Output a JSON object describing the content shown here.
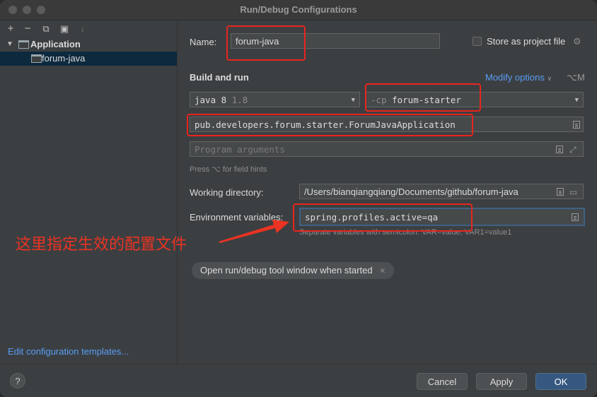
{
  "window": {
    "title": "Run/Debug Configurations"
  },
  "sidebar": {
    "toolbar": [
      {
        "icon": "add-icon",
        "glyph": "+"
      },
      {
        "icon": "remove-icon",
        "glyph": "−"
      },
      {
        "icon": "copy-icon",
        "glyph": "⧉"
      },
      {
        "icon": "folder-icon",
        "glyph": "▣"
      },
      {
        "icon": "sort-icon",
        "glyph": "↓"
      }
    ],
    "tree": {
      "group_label": "Application",
      "item_label": "forum-java"
    },
    "edit_templates": "Edit configuration templates..."
  },
  "form": {
    "name_label": "Name:",
    "name_value": "forum-java",
    "store_label": "Store as project file",
    "build_run_label": "Build and run",
    "modify_options": "Modify options",
    "modify_shortcut": "⌥M",
    "jdk_value": "java 8",
    "jdk_version": "1.8",
    "cp_prefix": "-cp",
    "cp_value": "forum-starter",
    "main_class": "pub.developers.forum.starter.ForumJavaApplication",
    "program_args_placeholder": "Program arguments",
    "field_hint": "Press ⌥ for field hints",
    "working_dir_label": "Working directory:",
    "working_dir_value": "/Users/bianqiangqiang/Documents/github/forum-java",
    "env_label": "Environment variables:",
    "env_value": "spring.profiles.active=qa",
    "env_hint": "Separate variables with semicolon: VAR=value; VAR1=value1",
    "chip_label": "Open run/debug tool window when started"
  },
  "annotation": {
    "text": "这里指定生效的配置文件",
    "color": "#ea3323"
  },
  "footer": {
    "help": "?",
    "cancel": "Cancel",
    "apply": "Apply",
    "ok": "OK"
  },
  "colors": {
    "accent": "#589df6",
    "annotation_red": "#e8251e",
    "selection": "#0d293e"
  }
}
